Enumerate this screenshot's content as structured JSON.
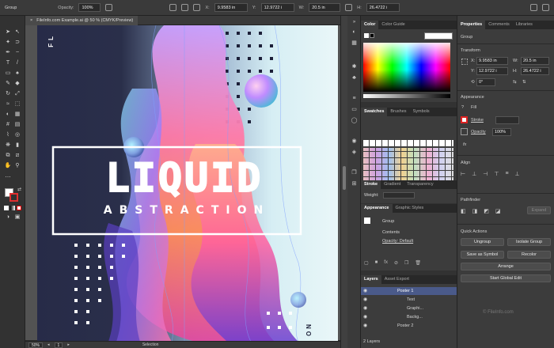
{
  "control_bar": {
    "selection": "Group",
    "opacity_label": "Opacity:",
    "opacity_value": "100%",
    "x_label": "X:",
    "x_value": "9.9583 in",
    "y_label": "Y:",
    "y_value": "12.9722 i",
    "w_label": "W:",
    "w_value": "20.5 in",
    "h_label": "H:",
    "h_value": "26.4722 i"
  },
  "document": {
    "tab_title": "FileInfo.com Example.ai @ 50 % (CMYK/Preview)",
    "close_glyph": "×"
  },
  "artwork": {
    "title": "LIQUID",
    "subtitle": "ABSTRACTION",
    "side_text": "FL",
    "corner_text": "NO",
    "colors": {
      "navy": "#272b48",
      "pink": "#f25b9a",
      "orange": "#ff8a5a",
      "purple": "#7a4fd0",
      "cyan": "#7fd6e8"
    }
  },
  "status_bar": {
    "zoom": "50%",
    "page": "1",
    "tool": "Selection"
  },
  "color_panel": {
    "tabs": [
      "Color",
      "Color Guide"
    ]
  },
  "swatches_panel": {
    "tabs": [
      "Swatches",
      "Brushes",
      "Symbols"
    ]
  },
  "stroke_panel": {
    "tabs": [
      "Stroke",
      "Gradient",
      "Transparency"
    ],
    "weight_label": "Weight:"
  },
  "appearance_panel": {
    "tabs": [
      "Appearance",
      "Graphic Styles"
    ],
    "group_label": "Group",
    "contents_label": "Contents",
    "opacity_row": "Opacity: Default"
  },
  "layers_panel": {
    "tabs": [
      "Layers",
      "Asset Export"
    ],
    "layers": [
      "Poster 1",
      "Text",
      "Graphi...",
      "Backg...",
      "Poster 2"
    ],
    "count": "2 Layers"
  },
  "properties": {
    "tabs": [
      "Properties",
      "Comments",
      "Libraries"
    ],
    "group_label": "Group",
    "transform_label": "Transform",
    "x_label": "X:",
    "x_value": "9.9583 in",
    "y_label": "Y:",
    "y_value": "12.9722 i",
    "w_label": "W:",
    "w_value": "20.5 in",
    "h_label": "H:",
    "h_value": "26.4722 i",
    "angle_value": "0°",
    "appearance_label": "Appearance",
    "fill_label": "Fill",
    "stroke_label": "Stroke",
    "opacity_label": "Opacity",
    "opacity_value": "100%",
    "fx_label": "fx",
    "align_label": "Align",
    "pathfinder_label": "Pathfinder",
    "expand_label": "Expand",
    "quick_actions_label": "Quick Actions",
    "btn_ungroup": "Ungroup",
    "btn_isolate": "Isolate Group",
    "btn_save_symbol": "Save as Symbol",
    "btn_recolor": "Recolor",
    "btn_arrange": "Arrange",
    "btn_global_edit": "Start Global Edit",
    "watermark": "© FileInfo.com"
  }
}
